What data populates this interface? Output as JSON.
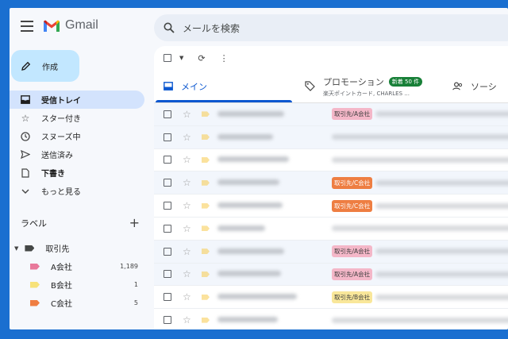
{
  "app": {
    "name": "Gmail"
  },
  "search": {
    "placeholder": "メールを検索"
  },
  "compose": {
    "label": "作成"
  },
  "nav": [
    {
      "label": "受信トレイ",
      "icon": "inbox-icon",
      "active": true
    },
    {
      "label": "スター付き",
      "icon": "star-icon"
    },
    {
      "label": "スヌーズ中",
      "icon": "clock-icon"
    },
    {
      "label": "送信済み",
      "icon": "send-icon"
    },
    {
      "label": "下書き",
      "icon": "draft-icon",
      "bold": true
    },
    {
      "label": "もっと見る",
      "icon": "chevron-down-icon"
    }
  ],
  "labels": {
    "title": "ラベル",
    "parent": {
      "name": "取引先",
      "color": "#444746"
    },
    "items": [
      {
        "name": "A会社",
        "count": "1,189",
        "color": "#e8799b"
      },
      {
        "name": "B会社",
        "count": "1",
        "color": "#f7e27a"
      },
      {
        "name": "C会社",
        "count": "5",
        "color": "#ef7e42"
      }
    ]
  },
  "tabs": {
    "primary": "メイン",
    "promotions": {
      "label": "プロモーション",
      "badge": "新着 50 件",
      "sub": "楽天ポイントカード, CHARLES ..."
    },
    "social": "ソーシ"
  },
  "emails": [
    {
      "chip": "取引先/A会社",
      "chip_color": "#f4b7c8",
      "read": true
    },
    {
      "chip": "",
      "read": true
    },
    {
      "chip": "",
      "read": false
    },
    {
      "chip": "取引先/C会社",
      "chip_color": "#ee7e42",
      "chip_text_color": "#ffffff",
      "read": true
    },
    {
      "chip": "取引先/C会社",
      "chip_color": "#ee7e42",
      "chip_text_color": "#ffffff",
      "read": false
    },
    {
      "chip": "",
      "read": false
    },
    {
      "chip": "取引先/A会社",
      "chip_color": "#f4b7c8",
      "read": true
    },
    {
      "chip": "取引先/A会社",
      "chip_color": "#f4b7c8",
      "read": true
    },
    {
      "chip": "取引先/B会社",
      "chip_color": "#f9e79a",
      "read": false
    },
    {
      "chip": "",
      "read": false
    }
  ]
}
